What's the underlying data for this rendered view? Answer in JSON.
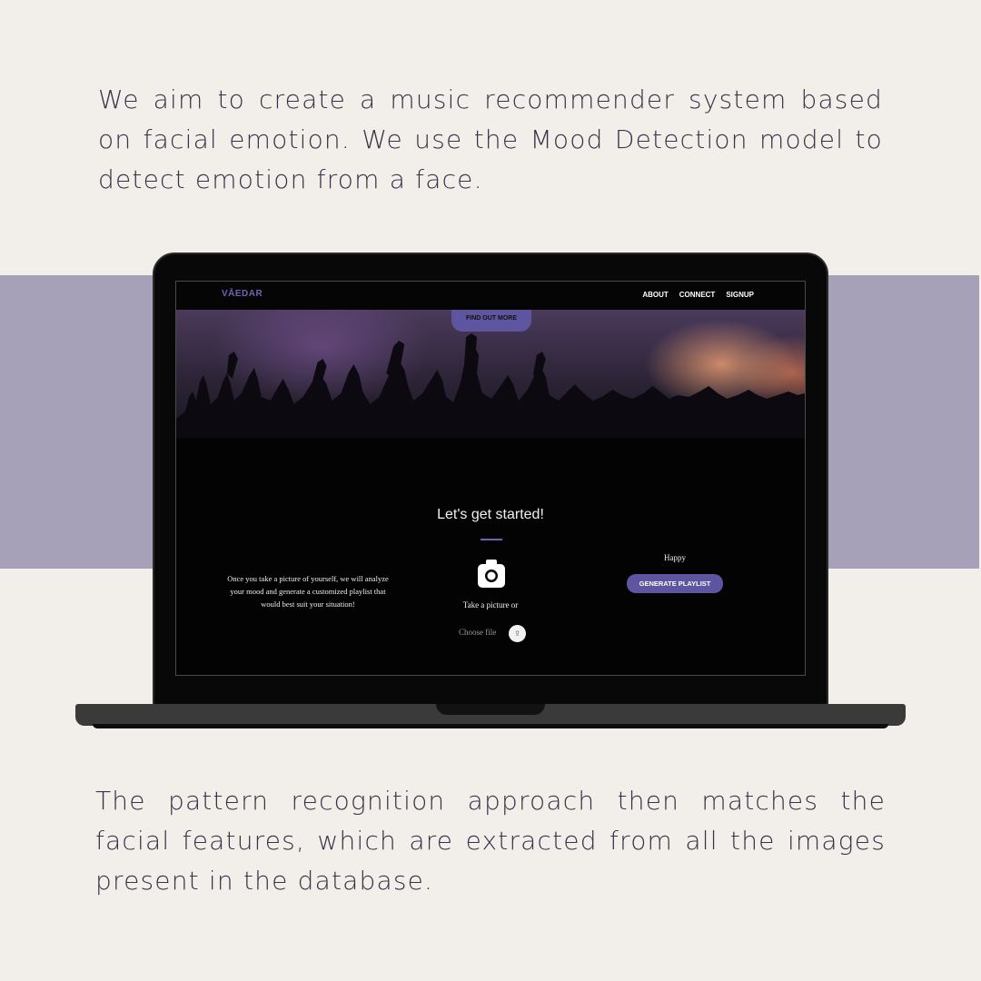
{
  "intro_text": "We aim to create a music recommender system based on facial emotion. We use the Mood Detection model to detect emotion from a face.",
  "outro_text": "The pattern recognition approach then matches the facial features, which are extracted from all the images present in the database.",
  "colors": {
    "background": "#f2efeb",
    "band": "#a6a1b9",
    "text": "#3a3147",
    "accent": "#5e55a0"
  },
  "site": {
    "brand": "VĀEDAR",
    "nav": [
      "ABOUT",
      "CONNECT",
      "SIGNUP"
    ],
    "hero_button": "FIND OUT MORE",
    "heading": "Let's get started!",
    "description": "Once you take a picture of yourself, we will analyze your mood and generate a customized playlist that would best suit your situation!",
    "camera_icon": "camera-icon",
    "take_picture": "Take a picture or",
    "choose_file": "Choose file",
    "upload_icon": "upload-icon",
    "mood_label": "Happy",
    "generate_button": "GENERATE PLAYLIST"
  }
}
